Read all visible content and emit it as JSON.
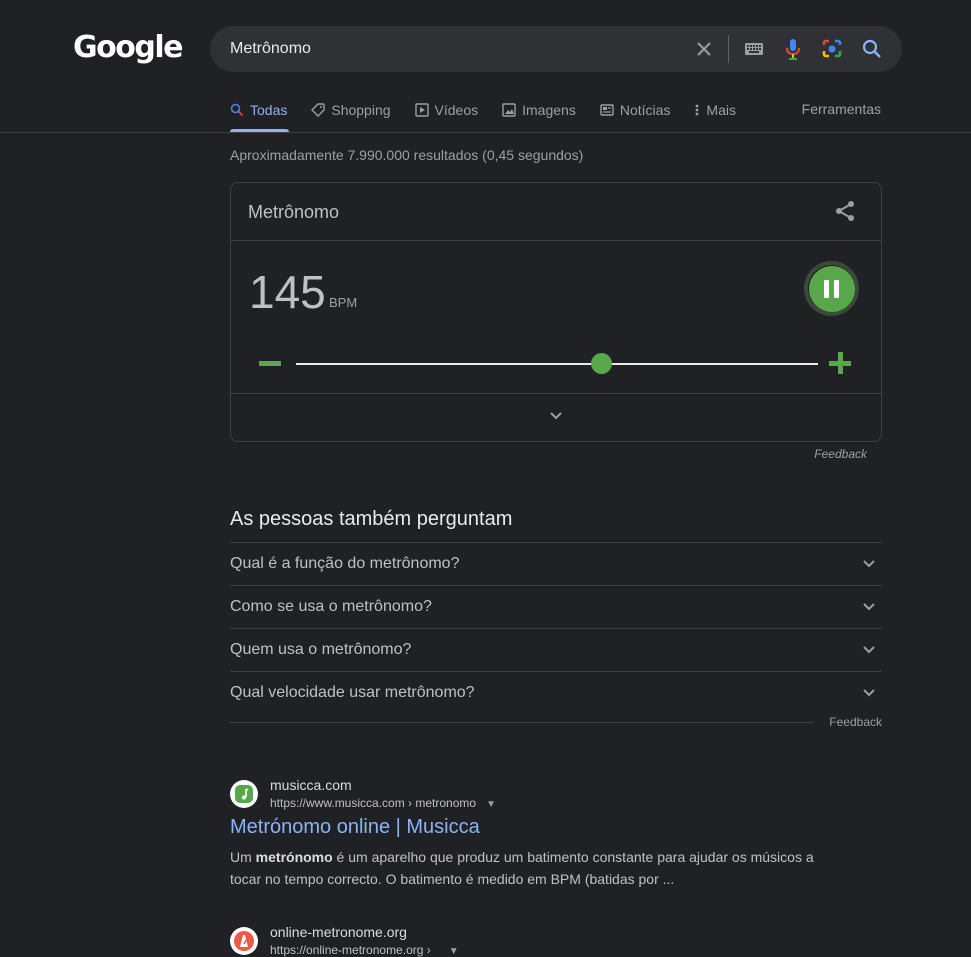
{
  "logo": "Google",
  "search": {
    "query": "Metrônomo"
  },
  "tabs": [
    {
      "label": "Todas",
      "icon": "search-icon"
    },
    {
      "label": "Shopping",
      "icon": "tag-icon"
    },
    {
      "label": "Vídeos",
      "icon": "video-icon"
    },
    {
      "label": "Imagens",
      "icon": "image-icon"
    },
    {
      "label": "Notícias",
      "icon": "news-icon"
    },
    {
      "label": "Mais",
      "icon": "more-vert-icon"
    }
  ],
  "tools_label": "Ferramentas",
  "stats": "Aproximadamente 7.990.000 resultados (0,45 segundos)",
  "metronome": {
    "title": "Metrônomo",
    "bpm": "145",
    "bpm_unit": "BPM",
    "slider_fraction": 0.585,
    "state": "playing"
  },
  "feedback_label": "Feedback",
  "paa": {
    "title": "As pessoas também perguntam",
    "questions": [
      "Qual é a função do metrônomo?",
      "Como se usa o metrônomo?",
      "Quem usa o metrônomo?",
      "Qual velocidade usar metrônomo?"
    ],
    "feedback_label": "Feedback"
  },
  "results": [
    {
      "site": "musicca.com",
      "url": "https://www.musicca.com › metronomo",
      "title": "Metrónomo online | Musicca",
      "snippet_before": "Um ",
      "snippet_bold": "metrónomo",
      "snippet_after": " é um aparelho que produz um batimento constante para ajudar os músicos a tocar no tempo correcto. O batimento é medido em BPM (batidas por ..."
    },
    {
      "site": "online-metronome.org",
      "url": "https://online-metronome.org ›"
    }
  ],
  "colors": {
    "accent": "#8ab4f8",
    "green": "#58a84b",
    "bg": "#202124"
  }
}
